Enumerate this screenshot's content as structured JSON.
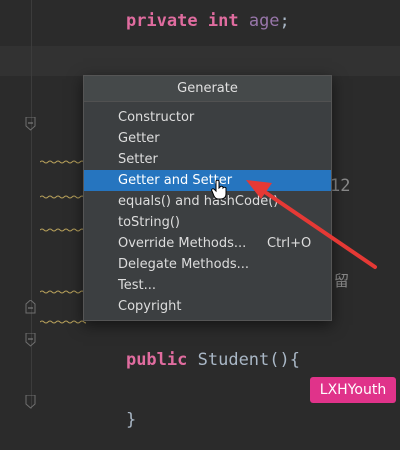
{
  "code": {
    "line1": {
      "keyword1": "private",
      "keyword2": "int",
      "field": "age",
      "punct": ";"
    },
    "line2": {
      "keyword": "public",
      "class_name": "Student",
      "punct": "(){"
    },
    "line3": {
      "punct": "}"
    },
    "peek_number": "12",
    "peek_cjk": "留"
  },
  "popup": {
    "title": "Generate",
    "items": [
      {
        "label": "Constructor",
        "shortcut": ""
      },
      {
        "label": "Getter",
        "shortcut": ""
      },
      {
        "label": "Setter",
        "shortcut": ""
      },
      {
        "label": "Getter and Setter",
        "shortcut": "",
        "selected": true
      },
      {
        "label": "equals() and hashCode()",
        "shortcut": ""
      },
      {
        "label": "toString()",
        "shortcut": ""
      },
      {
        "label": "Override Methods...",
        "shortcut": "Ctrl+O"
      },
      {
        "label": "Delegate Methods...",
        "shortcut": ""
      },
      {
        "label": "Test...",
        "shortcut": ""
      },
      {
        "label": "Copyright",
        "shortcut": ""
      }
    ]
  },
  "watermark": {
    "text": "LXHYouth"
  },
  "colors": {
    "background": "#2b2b2b",
    "selection": "#2675bf",
    "arrow": "#e53935",
    "keyword_pink": "#e06c9f",
    "watermark_bg": "#e0338a"
  }
}
